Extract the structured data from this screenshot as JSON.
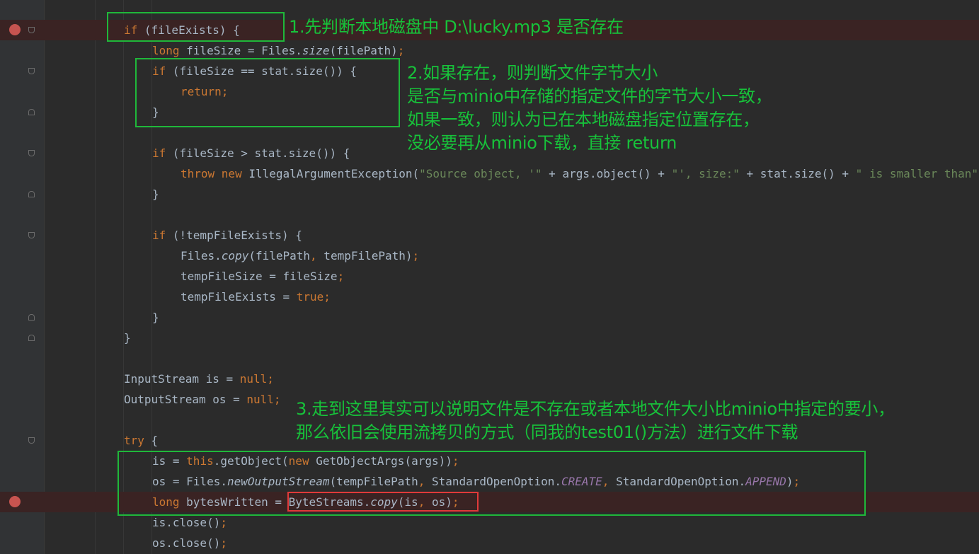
{
  "code_lines": [
    {
      "tokens": [
        {
          "t": "kw",
          "v": "if"
        },
        {
          "t": "p",
          "v": " (fileExists) {"
        }
      ]
    },
    {
      "tokens": [
        {
          "t": "kw",
          "v": "long"
        },
        {
          "t": "p",
          "v": " fileSize = Files."
        },
        {
          "t": "fn",
          "v": "size"
        },
        {
          "t": "p",
          "v": "(filePath)"
        },
        {
          "t": "kw",
          "v": ";"
        }
      ]
    },
    {
      "tokens": [
        {
          "t": "kw",
          "v": "if"
        },
        {
          "t": "p",
          "v": " (fileSize == stat.size()) {"
        }
      ]
    },
    {
      "tokens": [
        {
          "t": "kw",
          "v": "return;"
        }
      ]
    },
    {
      "tokens": [
        {
          "t": "p",
          "v": "}"
        }
      ]
    },
    {
      "tokens": []
    },
    {
      "tokens": [
        {
          "t": "kw",
          "v": "if"
        },
        {
          "t": "p",
          "v": " (fileSize > stat.size()) {"
        }
      ]
    },
    {
      "tokens": [
        {
          "t": "kw",
          "v": "throw new"
        },
        {
          "t": "p",
          "v": " IllegalArgumentException("
        },
        {
          "t": "str",
          "v": "\"Source object, '\""
        },
        {
          "t": "p",
          "v": " + args.object() + "
        },
        {
          "t": "str",
          "v": "\"', size:\""
        },
        {
          "t": "p",
          "v": " + stat.size() + "
        },
        {
          "t": "str",
          "v": "\" is smaller than\""
        }
      ]
    },
    {
      "tokens": [
        {
          "t": "p",
          "v": "}"
        }
      ]
    },
    {
      "tokens": []
    },
    {
      "tokens": [
        {
          "t": "kw",
          "v": "if"
        },
        {
          "t": "p",
          "v": " (!tempFileExists) {"
        }
      ]
    },
    {
      "tokens": [
        {
          "t": "p",
          "v": "Files."
        },
        {
          "t": "fn",
          "v": "copy"
        },
        {
          "t": "p",
          "v": "(filePath"
        },
        {
          "t": "kw",
          "v": ","
        },
        {
          "t": "p",
          "v": " tempFilePath)"
        },
        {
          "t": "kw",
          "v": ";"
        }
      ]
    },
    {
      "tokens": [
        {
          "t": "p",
          "v": "tempFileSize = fileSize"
        },
        {
          "t": "kw",
          "v": ";"
        }
      ]
    },
    {
      "tokens": [
        {
          "t": "p",
          "v": "tempFileExists = "
        },
        {
          "t": "kw",
          "v": "true;"
        }
      ]
    },
    {
      "tokens": [
        {
          "t": "p",
          "v": "}"
        }
      ]
    },
    {
      "tokens": [
        {
          "t": "p",
          "v": "}"
        }
      ]
    },
    {
      "tokens": []
    },
    {
      "tokens": [
        {
          "t": "p",
          "v": "InputStream is = "
        },
        {
          "t": "kw",
          "v": "null;"
        }
      ]
    },
    {
      "tokens": [
        {
          "t": "p",
          "v": "OutputStream os = "
        },
        {
          "t": "kw",
          "v": "null;"
        }
      ]
    },
    {
      "tokens": []
    },
    {
      "tokens": [
        {
          "t": "kw",
          "v": "try"
        },
        {
          "t": "p",
          "v": " {"
        }
      ]
    },
    {
      "tokens": [
        {
          "t": "p",
          "v": "is = "
        },
        {
          "t": "kw",
          "v": "this"
        },
        {
          "t": "p",
          "v": ".getObject("
        },
        {
          "t": "kw",
          "v": "new"
        },
        {
          "t": "p",
          "v": " GetObjectArgs(args))"
        },
        {
          "t": "kw",
          "v": ";"
        }
      ]
    },
    {
      "tokens": [
        {
          "t": "p",
          "v": "os = Files."
        },
        {
          "t": "fn",
          "v": "newOutputStream"
        },
        {
          "t": "p",
          "v": "(tempFilePath"
        },
        {
          "t": "kw",
          "v": ","
        },
        {
          "t": "p",
          "v": " StandardOpenOption."
        },
        {
          "t": "const",
          "v": "CREATE"
        },
        {
          "t": "kw",
          "v": ","
        },
        {
          "t": "p",
          "v": " StandardOpenOption."
        },
        {
          "t": "const",
          "v": "APPEND"
        },
        {
          "t": "p",
          "v": ")"
        },
        {
          "t": "kw",
          "v": ";"
        }
      ]
    },
    {
      "tokens": [
        {
          "t": "kw",
          "v": "long"
        },
        {
          "t": "p",
          "v": " bytesWritten = ByteStreams."
        },
        {
          "t": "fn",
          "v": "copy"
        },
        {
          "t": "p",
          "v": "(is"
        },
        {
          "t": "kw",
          "v": ","
        },
        {
          "t": "p",
          "v": " os)"
        },
        {
          "t": "kw",
          "v": ";"
        }
      ]
    },
    {
      "tokens": [
        {
          "t": "p",
          "v": "is.close()"
        },
        {
          "t": "kw",
          "v": ";"
        }
      ]
    },
    {
      "tokens": [
        {
          "t": "p",
          "v": "os.close()"
        },
        {
          "t": "kw",
          "v": ";"
        }
      ]
    }
  ],
  "annotations": {
    "note1": "1.先判断本地磁盘中 D:\\lucky.mp3 是否存在",
    "note2": "2.如果存在，则判断文件字节大小\n是否与minio中存储的指定文件的字节大小一致，\n如果一致，则认为已在本地磁盘指定位置存在，\n没必要再从minio下载，直接 return",
    "note3": "3.走到这里其实可以说明文件是不存在或者本地文件大小比minio中指定的要小，\n那么依旧会使用流拷贝的方式（同我的test01()方法）进行文件下载"
  },
  "colors": {
    "background": "#2b2b2b",
    "keyword": "#cc7832",
    "string": "#6a8759",
    "constant": "#9876aa",
    "plain": "#a9b7c6",
    "annotation": "#17c23a",
    "breakpoint": "#c75450",
    "highlight_red": "#e03a3a"
  },
  "icons": {
    "breakpoint": "breakpoint-icon",
    "fold": "fold-marker-icon"
  }
}
